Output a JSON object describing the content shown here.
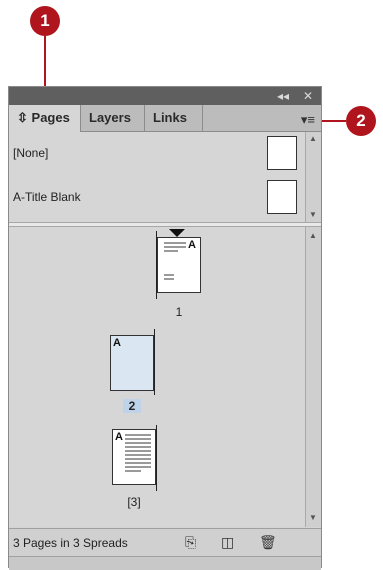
{
  "callouts": {
    "one": "1",
    "two": "2"
  },
  "titlebar": {
    "collapse_icon": "◂◂",
    "close_icon": "✕"
  },
  "tabs": [
    {
      "label": "Pages",
      "icon": "⇳"
    },
    {
      "label": "Layers"
    },
    {
      "label": "Links"
    }
  ],
  "panel_menu_icon": "▾≡",
  "masters": [
    {
      "label": "[None]"
    },
    {
      "label": "A-Title Blank"
    }
  ],
  "pages": [
    {
      "number": "1",
      "prefix": "A"
    },
    {
      "number": "2",
      "prefix": "A"
    },
    {
      "number": "[3]",
      "prefix": "A"
    }
  ],
  "status": {
    "text": "3 Pages in 3 Spreads",
    "page_size_icon": "⎘",
    "new_page_icon": "◫",
    "delete_icon": "🗑"
  },
  "colors": {
    "callout": "#b0151d",
    "panel_bg": "#d6d6d6",
    "titlebar": "#5f5f5f",
    "selected": "#bed3ea"
  }
}
